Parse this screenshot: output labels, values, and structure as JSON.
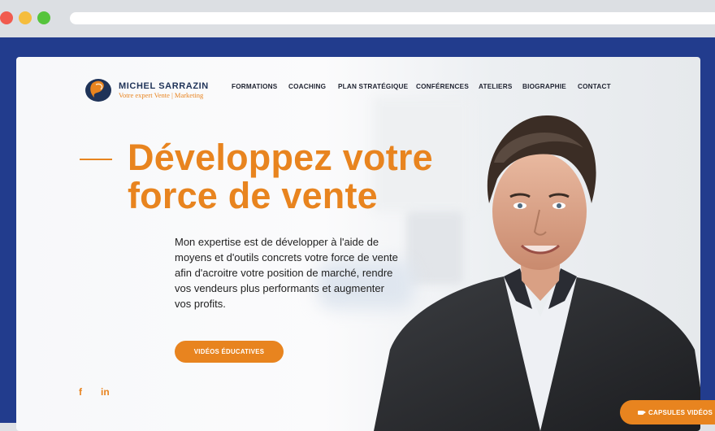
{
  "brand": {
    "name": "MICHEL SARRAZIN",
    "tagline": "Votre expert Vente | Marketing",
    "accent_color": "#e8841f",
    "frame_color": "#223c8d"
  },
  "nav": {
    "items": [
      "FORMATIONS",
      "COACHING",
      "PLAN STRATÉGIQUE",
      "CONFÉRENCES",
      "ATELIERS",
      "BIOGRAPHIE",
      "CONTACT"
    ]
  },
  "hero": {
    "title_line1": "Développez votre",
    "title_line2": "force de vente",
    "text": "Mon expertise est de développer à l'aide de moyens et d'outils concrets votre force de vente afin d'acroitre votre position de marché, rendre vos vendeurs plus performants et augmenter vos profits.",
    "cta_label": "VIDÉOS ÉDUCATIVES"
  },
  "social": {
    "facebook": "f",
    "linkedin": "in"
  },
  "floating": {
    "capsules_label": "CAPSULES VIDÉOS"
  }
}
